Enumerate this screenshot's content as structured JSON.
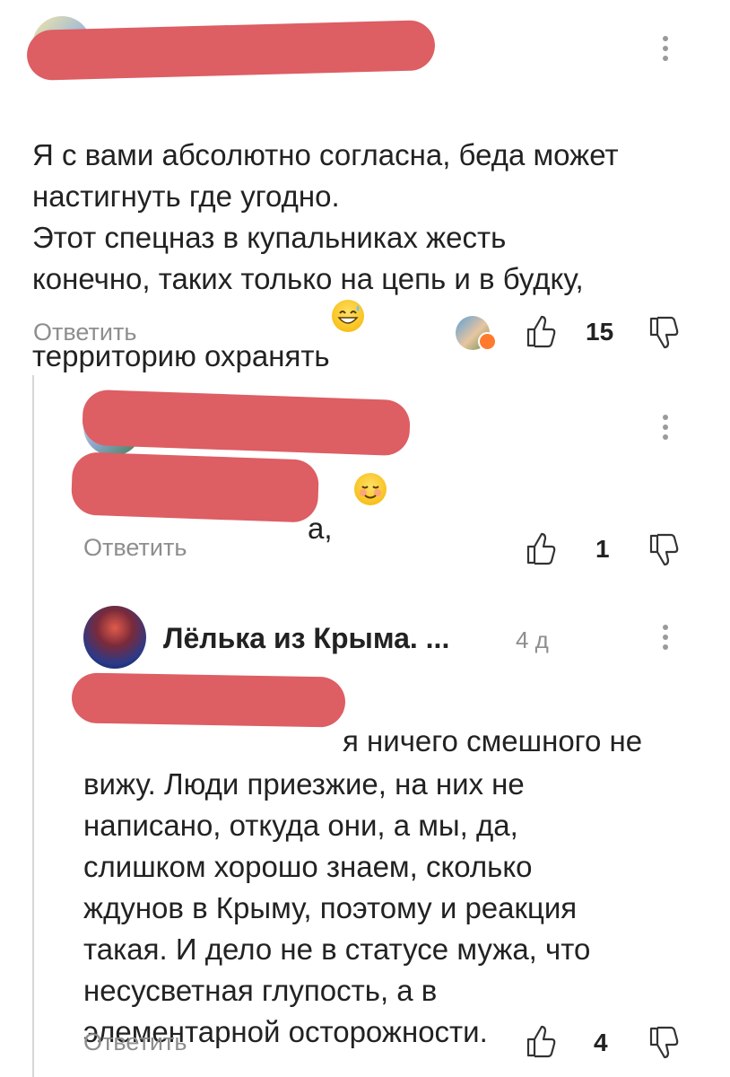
{
  "comments": [
    {
      "text": "Я с вами абсолютно согласна, беда может\nнастигнуть где угодно.\nЭтот спецназ в купальниках жесть\nконечно, таких только на цепь и в будку,\nтерриторию охранять",
      "reply_label": "Ответить",
      "likes": "15",
      "emoji": "grinning-sweat-emoji"
    },
    {
      "text_visible_fragment": "а,",
      "reply_label": "Ответить",
      "likes": "1",
      "emoji": "smiling-blush-emoji"
    },
    {
      "author": "Лёлька из Крыма. ...",
      "time": "4 д",
      "text_first_line_fragment": "я ничего смешного не",
      "text": "вижу. Люди приезжие, на них не\nнаписано, откуда они, а мы, да,\nслишком хорошо знаем, сколько\nждунов в Крыму, поэтому и реакция\nтакая. И дело не в статусе мужа, что\nнесусветная глупость, а в\nэлементарной осторожности.",
      "reply_label": "Ответить",
      "likes": "4"
    }
  ],
  "colors": {
    "redaction": "#dd5e63",
    "muted_text": "#8e8e8e",
    "thread_line": "#d7d7d7"
  }
}
